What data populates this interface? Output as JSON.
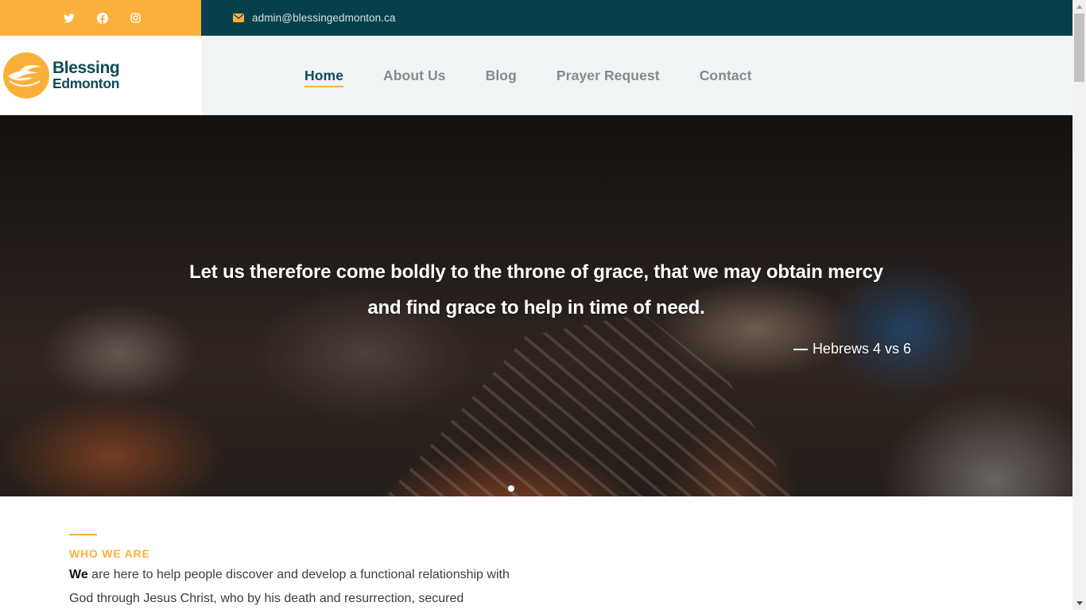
{
  "topbar": {
    "social": [
      {
        "icon": "twitter-icon",
        "label": "Twitter"
      },
      {
        "icon": "facebook-icon",
        "label": "Facebook"
      },
      {
        "icon": "instagram-icon",
        "label": "Instagram"
      }
    ],
    "email": "admin@blessingedmonton.ca",
    "colors": {
      "social_bg": "#fbb03b",
      "contact_bg": "#06414b"
    }
  },
  "logo": {
    "line1": "Blessing",
    "line2": "Edmonton",
    "icon": "dove-icon"
  },
  "nav": {
    "items": [
      {
        "label": "Home",
        "active": true
      },
      {
        "label": "About Us",
        "active": false
      },
      {
        "label": "Blog",
        "active": false
      },
      {
        "label": "Prayer Request",
        "active": false
      },
      {
        "label": "Contact",
        "active": false
      }
    ]
  },
  "hero": {
    "quote_line1": "Let us therefore come boldly to the throne of grace, that we may obtain mercy",
    "quote_line2": "and find grace to help in time of need.",
    "citation": "Hebrews 4 vs 6",
    "slides_total": 1,
    "active_slide": 1
  },
  "about": {
    "eyebrow": "WHO WE ARE",
    "lead_word": "We",
    "text": " are here to help people discover and develop a functional relationship with God through Jesus Christ, who by his death and resurrection, secured"
  },
  "colors": {
    "accent": "#fbb03b",
    "brand_dark": "#0d4b55"
  }
}
